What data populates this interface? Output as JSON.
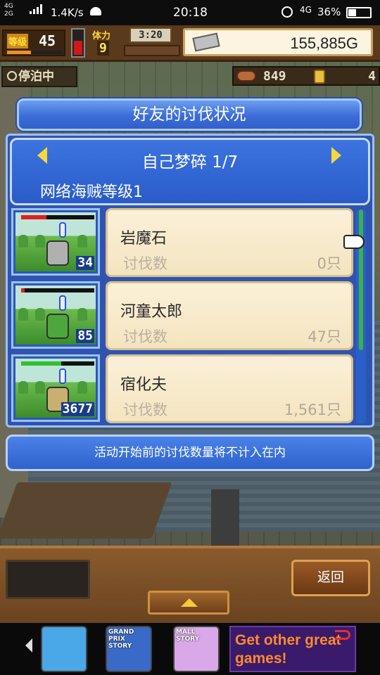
{
  "status_bar": {
    "signal_1": "4G",
    "signal_2": "2G",
    "net_speed": "1.4K/s",
    "time": "20:18",
    "network": "4G",
    "battery": "36%",
    "battery_level": 0.36
  },
  "hud": {
    "level_label": "等级",
    "level": "45",
    "stamina_label": "体力",
    "stamina": "9",
    "clock": "3:20",
    "money": "155,885G",
    "status": "停泊中",
    "resource_1": "849",
    "resource_2": "4"
  },
  "panel": {
    "title": "好友的讨伐状况",
    "subtitle": "自己梦碎 1/7",
    "pirate_level": "网络海贼等级1"
  },
  "monsters": [
    {
      "name": "岩魔石",
      "kill_label": "讨伐数",
      "kills": "0只",
      "level": "34",
      "hp_fraction": 0.35,
      "hp_color": "#e02020"
    },
    {
      "name": "河童太郎",
      "kill_label": "讨伐数",
      "kills": "47只",
      "level": "85",
      "hp_fraction": 0.05,
      "hp_color": "#e02020"
    },
    {
      "name": "宿化夫",
      "kill_label": "讨伐数",
      "kills": "1,561只",
      "level": "3677",
      "hp_fraction": 0.55,
      "hp_color": "#30c030"
    }
  ],
  "note": "活动开始前的讨伐数量将不计入在内",
  "buttons": {
    "back": "返回"
  },
  "ad": {
    "app_1": "",
    "app_2": "GRAND PRIX STORY",
    "app_3": "MALL STORY",
    "cta": "Get other great games!"
  },
  "colors": {
    "panel_blue": "#2f54b0",
    "title_blue": "#3c6cd8",
    "card_cream": "#fbf0d8",
    "arrow_yellow": "#f8d83a"
  }
}
